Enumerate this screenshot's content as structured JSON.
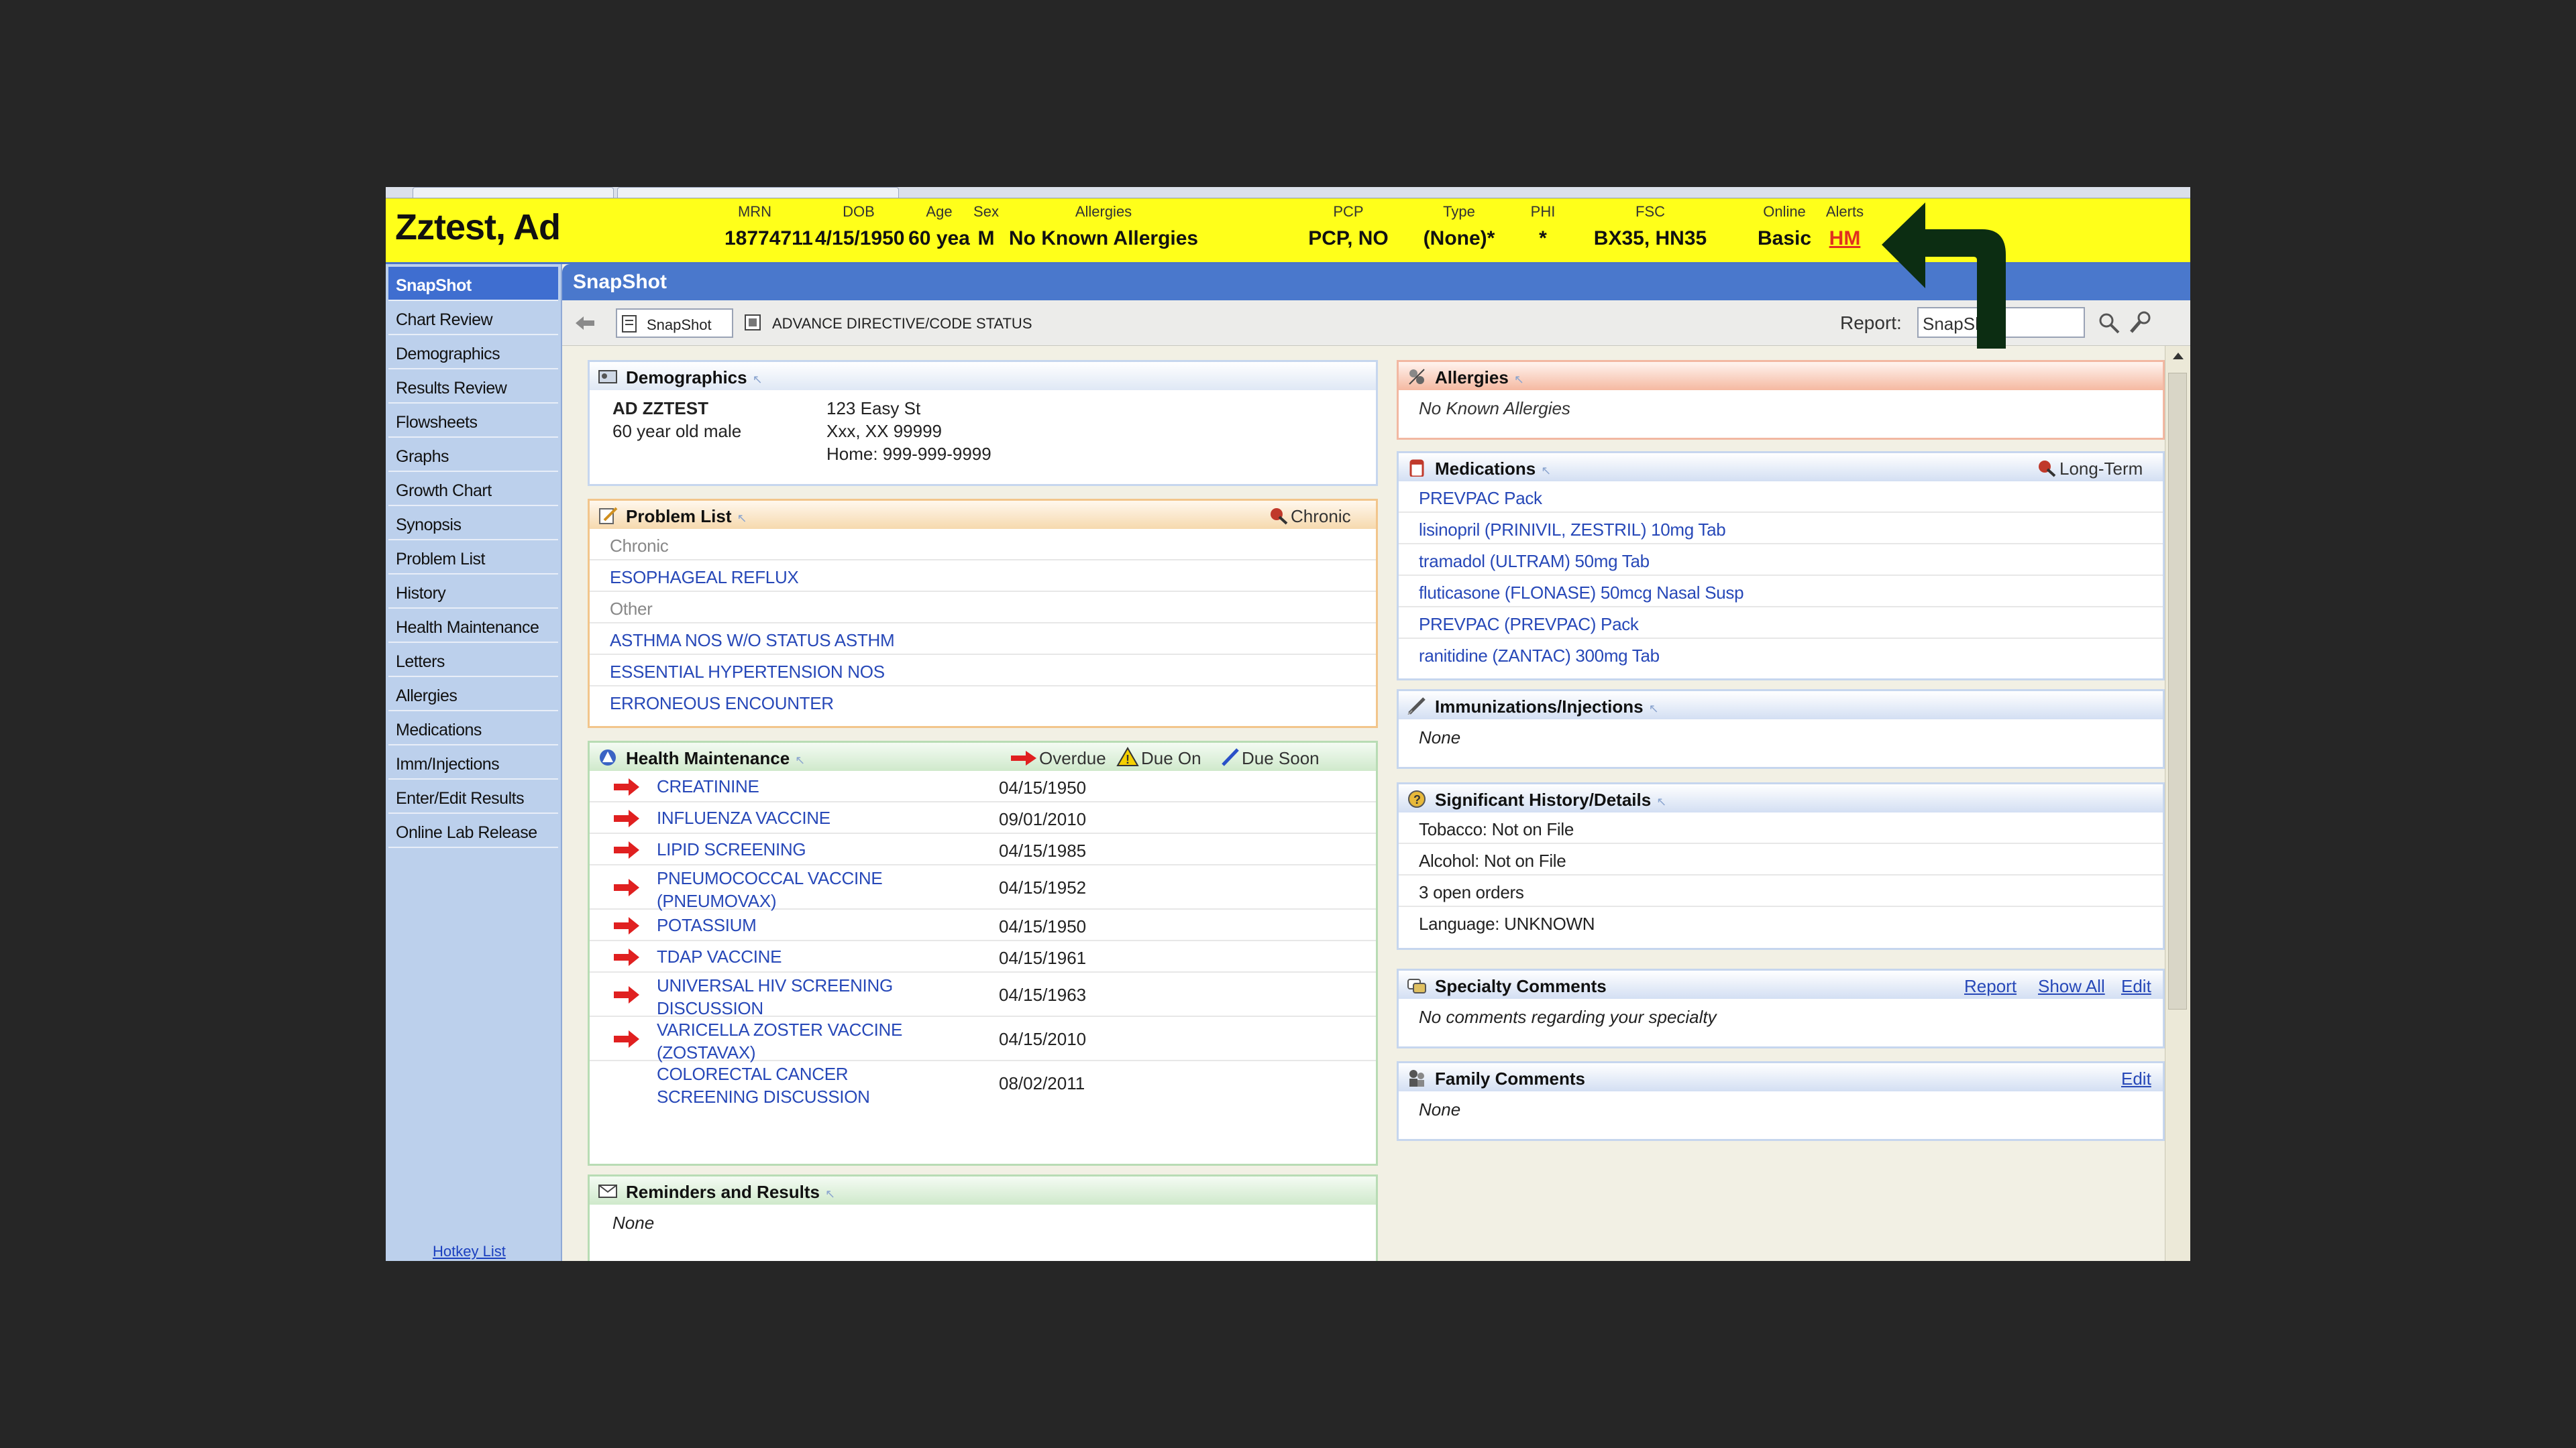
{
  "patient": {
    "name": "Zztest, Ad",
    "fields": [
      {
        "label": "MRN",
        "value": "18774711"
      },
      {
        "label": "DOB",
        "value": "4/15/1950"
      },
      {
        "label": "Age",
        "value": "60 yea"
      },
      {
        "label": "Sex",
        "value": "M"
      },
      {
        "label": "Allergies",
        "value": "No Known Allergies"
      },
      {
        "label": "PCP",
        "value": "PCP, NO"
      },
      {
        "label": "Type",
        "value": "(None)*"
      },
      {
        "label": "PHI",
        "value": "*"
      },
      {
        "label": "FSC",
        "value": "BX35, HN35"
      },
      {
        "label": "Online",
        "value": "Basic"
      },
      {
        "label": "Alerts",
        "value": "HM"
      }
    ]
  },
  "sidebar": {
    "items": [
      "SnapShot",
      "Chart Review",
      "Demographics",
      "Results Review",
      "Flowsheets",
      "Graphs",
      "Growth Chart",
      "Synopsis",
      "Problem List",
      "History",
      "Health Maintenance",
      "Letters",
      "Allergies",
      "Medications",
      "Imm/Injections",
      "Enter/Edit Results",
      "Online Lab Release"
    ],
    "active": "SnapShot",
    "hotkey": "Hotkey List"
  },
  "snapshot": {
    "title": "SnapShot",
    "toolbar": {
      "tab1": "SnapShot",
      "tab2": "ADVANCE DIRECTIVE/CODE STATUS",
      "report_label": "Report:",
      "report_value": "SnapShot"
    }
  },
  "demographics": {
    "title": "Demographics",
    "name": "AD ZZTEST",
    "desc": "60 year old male",
    "address1": "123 Easy St",
    "address2": "Xxx, XX 99999",
    "phone": "Home: 999-999-9999"
  },
  "problems": {
    "title": "Problem List",
    "legend": "Chronic",
    "rows": [
      {
        "text": "Chronic",
        "kind": "group"
      },
      {
        "text": "ESOPHAGEAL REFLUX",
        "kind": "item"
      },
      {
        "text": "Other",
        "kind": "group"
      },
      {
        "text": "ASTHMA NOS W/O STATUS ASTHM",
        "kind": "item"
      },
      {
        "text": "ESSENTIAL HYPERTENSION NOS",
        "kind": "item"
      },
      {
        "text": "ERRONEOUS ENCOUNTER",
        "kind": "item"
      }
    ]
  },
  "health_maintenance": {
    "title": "Health Maintenance",
    "legend": {
      "overdue": "Overdue",
      "due_on": "Due On",
      "due_soon": "Due Soon"
    },
    "rows": [
      {
        "name": "CREATININE",
        "date": "04/15/1950",
        "overdue": true
      },
      {
        "name": "INFLUENZA VACCINE",
        "date": "09/01/2010",
        "overdue": true
      },
      {
        "name": "LIPID SCREENING",
        "date": "04/15/1985",
        "overdue": true
      },
      {
        "name": "PNEUMOCOCCAL VACCINE (PNEUMOVAX)",
        "date": "04/15/1952",
        "overdue": true
      },
      {
        "name": "POTASSIUM",
        "date": "04/15/1950",
        "overdue": true
      },
      {
        "name": "TDAP VACCINE",
        "date": "04/15/1961",
        "overdue": true
      },
      {
        "name": "UNIVERSAL HIV SCREENING DISCUSSION",
        "date": "04/15/1963",
        "overdue": true
      },
      {
        "name": "VARICELLA ZOSTER VACCINE (ZOSTAVAX)",
        "date": "04/15/2010",
        "overdue": true
      },
      {
        "name": "COLORECTAL CANCER SCREENING DISCUSSION",
        "date": "08/02/2011",
        "overdue": false
      }
    ]
  },
  "reminders": {
    "title": "Reminders and Results",
    "text": "None"
  },
  "allergies": {
    "title": "Allergies",
    "text": "No Known Allergies"
  },
  "medications": {
    "title": "Medications",
    "legend": "Long-Term",
    "items": [
      "PREVPAC Pack",
      "lisinopril (PRINIVIL, ZESTRIL) 10mg Tab",
      "tramadol (ULTRAM) 50mg Tab",
      "fluticasone (FLONASE) 50mcg Nasal Susp",
      "PREVPAC (PREVPAC) Pack",
      "ranitidine (ZANTAC) 300mg Tab"
    ]
  },
  "immunizations": {
    "title": "Immunizations/Injections",
    "text": "None"
  },
  "history": {
    "title": "Significant History/Details",
    "items": [
      "Tobacco: Not on File",
      "Alcohol: Not on File",
      "3 open orders",
      "Language: UNKNOWN"
    ]
  },
  "specialty": {
    "title": "Specialty Comments",
    "links": {
      "report": "Report",
      "show_all": "Show All",
      "edit": "Edit"
    },
    "text": "No comments regarding your specialty"
  },
  "family": {
    "title": "Family Comments",
    "edit": "Edit",
    "text": "None"
  }
}
